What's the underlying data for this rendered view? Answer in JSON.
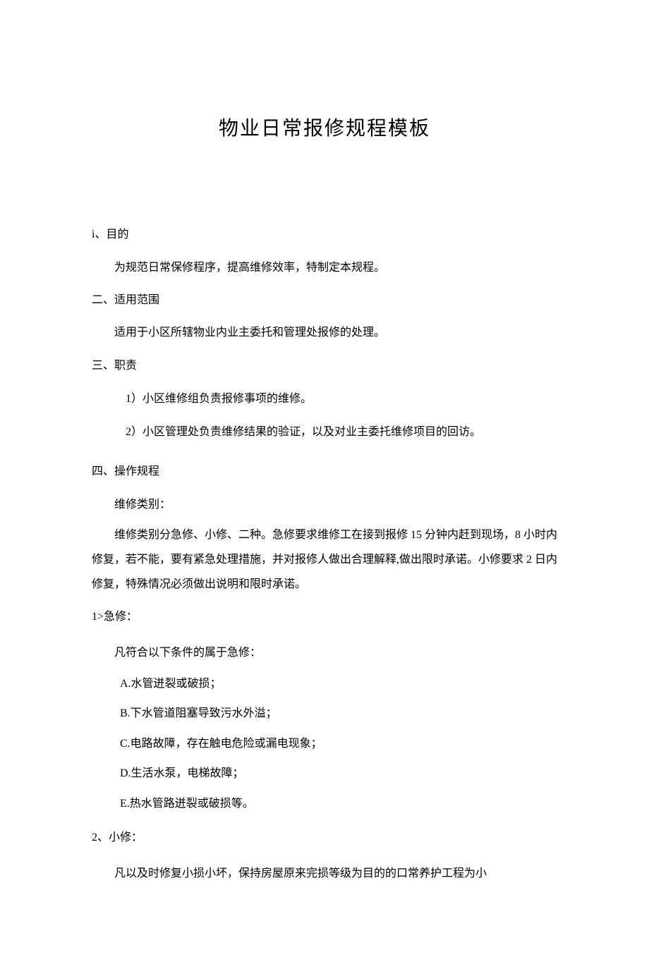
{
  "title": "物业日常报修规程模板",
  "sections": {
    "s1": {
      "heading": "i、目的",
      "body": "为规范日常保修程序，提高维修效率，特制定本规程。"
    },
    "s2": {
      "heading": "二、适用范围",
      "body": "适用于小区所辖物业内业主委托和管理处报修的处理。"
    },
    "s3": {
      "heading": "三、职责",
      "items": [
        "1）小区维修组负责报修事项的维修。",
        "2）小区管理处负责维修结果的验证，以及对业主委托维修项目的回访。"
      ]
    },
    "s4": {
      "heading": "四、操作规程",
      "sub1": "维修类别：",
      "para": "维修类别分急修、小修、二种。急修要求维修工在接到报修 15 分钟内赶到现场，8 小时内修复，若不能，要有紧急处理措施，并对报修人做出合理解释,做出限时承诺。小修要求 2 日内修复，特殊情况必须做出说明和限时承诺。"
    },
    "s5": {
      "heading": "1>急修：",
      "intro": "凡符合以下条件的属于急修：",
      "items": [
        "A.水管迸裂或破损；",
        "B.下水管道阻塞导致污水外溢；",
        "C.电路故障，存在触电危险或漏电现象；",
        "D.生活水泵，电梯故障；",
        "E.热水管路迸裂或破损等。"
      ]
    },
    "s6": {
      "heading": "2、小修：",
      "body": "凡以及时修复小损小坏，保持房屋原来完损等级为目的的口常养护工程为小"
    }
  }
}
